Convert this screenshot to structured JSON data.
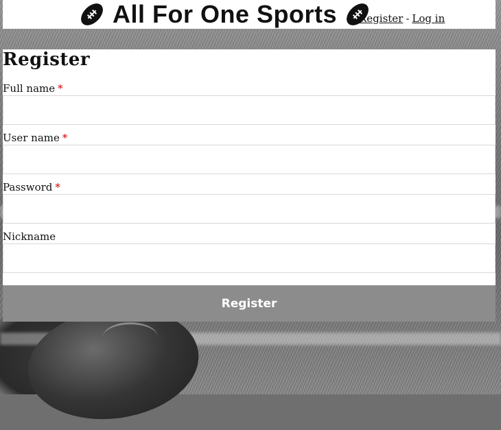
{
  "header": {
    "logo_text": "All For One Sports",
    "left_icon": "football-icon",
    "right_icon": "football-icon",
    "register_link": "Register",
    "separator": "-",
    "login_link": "Log in"
  },
  "form": {
    "title": "Register",
    "fields": [
      {
        "label": "Full name",
        "required": true,
        "required_mark": "*",
        "value": ""
      },
      {
        "label": "User name",
        "required": true,
        "required_mark": "*",
        "value": ""
      },
      {
        "label": "Password",
        "required": true,
        "required_mark": "*",
        "value": ""
      },
      {
        "label": "Nickname",
        "required": false,
        "value": ""
      }
    ],
    "submit_label": "Register"
  },
  "colors": {
    "required_mark": "#d00000",
    "submit_background": "#8c8c8c",
    "submit_text": "#ffffff"
  }
}
